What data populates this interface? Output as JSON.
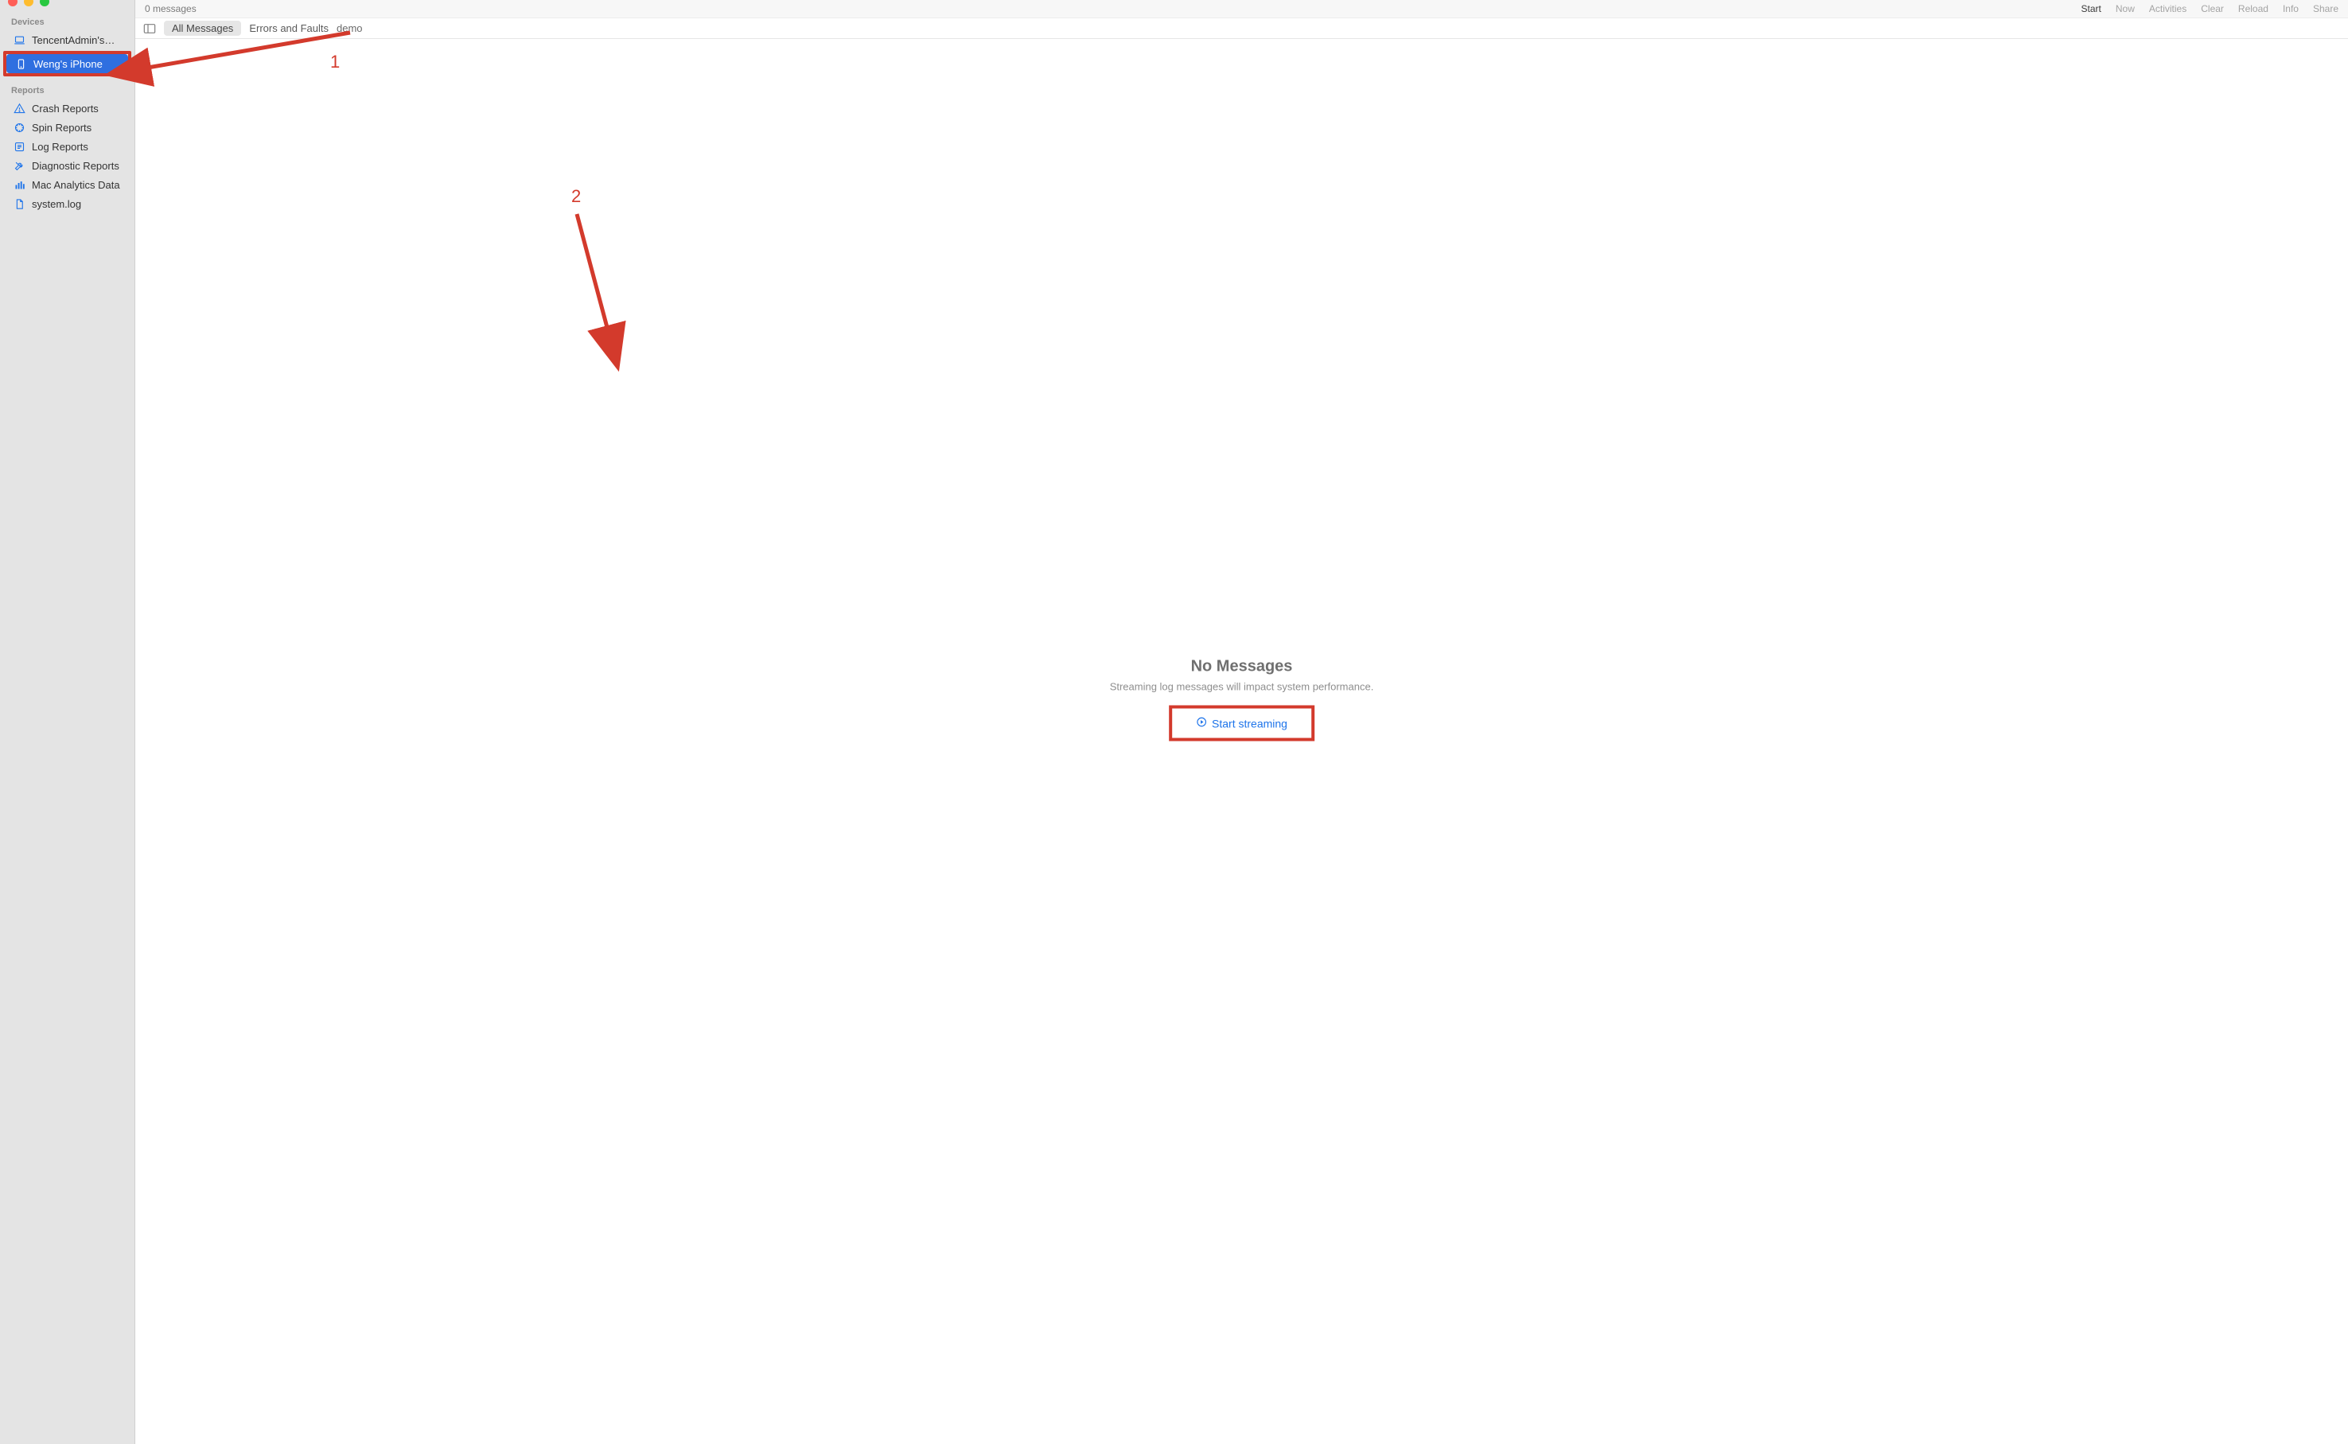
{
  "topbar": {
    "message_count": "0 messages",
    "actions": {
      "start": "Start",
      "now": "Now",
      "activities": "Activities",
      "clear": "Clear",
      "reload": "Reload",
      "info": "Info",
      "share": "Share"
    }
  },
  "filterbar": {
    "all_messages": "All Messages",
    "errors_faults": "Errors and Faults",
    "search_term": "demo"
  },
  "sidebar": {
    "devices_label": "Devices",
    "devices": [
      {
        "label": "TencentAdmin's…"
      },
      {
        "label": "Weng's iPhone"
      }
    ],
    "reports_label": "Reports",
    "reports": [
      {
        "label": "Crash Reports"
      },
      {
        "label": "Spin Reports"
      },
      {
        "label": "Log Reports"
      },
      {
        "label": "Diagnostic Reports"
      },
      {
        "label": "Mac Analytics Data"
      },
      {
        "label": "system.log"
      }
    ]
  },
  "empty": {
    "title": "No Messages",
    "subtitle": "Streaming log messages will impact system performance.",
    "link": "Start streaming"
  },
  "annotations": {
    "one": "1",
    "two": "2"
  }
}
